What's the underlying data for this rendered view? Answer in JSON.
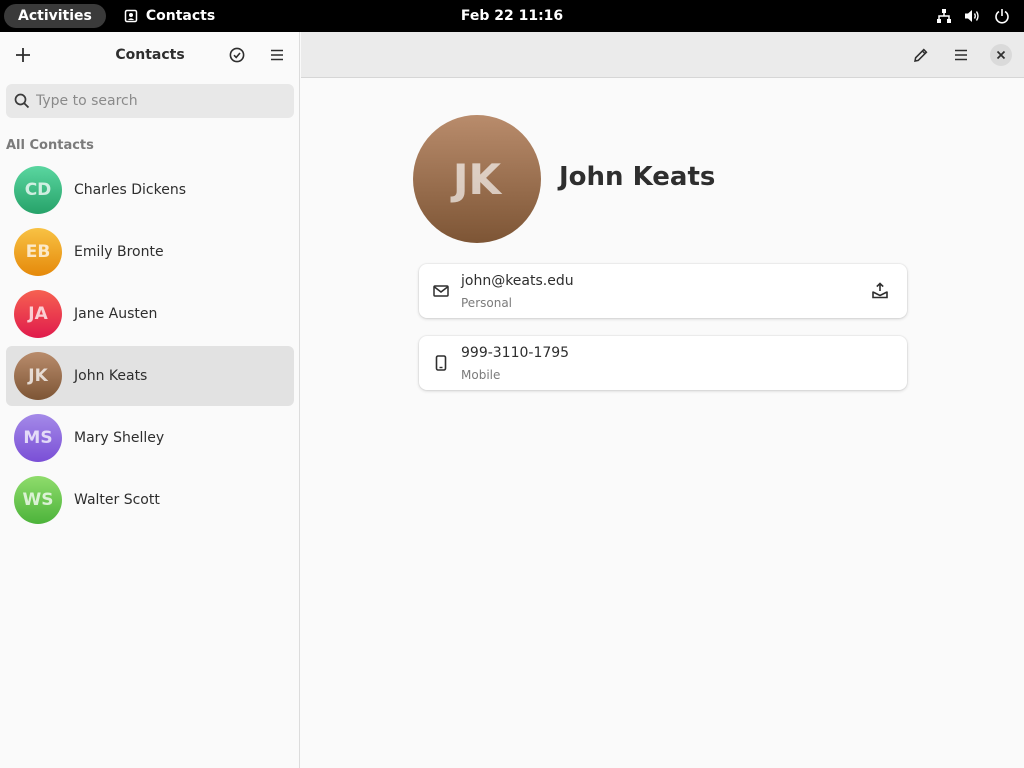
{
  "topbar": {
    "activities_label": "Activities",
    "app_name": "Contacts",
    "clock": "Feb 22  11:16",
    "icons": [
      "network-icon",
      "volume-icon",
      "power-icon"
    ]
  },
  "sidebar": {
    "title": "Contacts",
    "header_icons": [
      "add-icon",
      "select-icon",
      "menu-icon"
    ],
    "search": {
      "placeholder": "Type to search",
      "value": ""
    },
    "section_label": "All Contacts",
    "contacts": [
      {
        "initials": "CD",
        "name": "Charles Dickens",
        "color_top": "#5ad6a0",
        "color_bottom": "#26a269",
        "selected": false
      },
      {
        "initials": "EB",
        "name": "Emily Bronte",
        "color_top": "#f8c244",
        "color_bottom": "#e5890a",
        "selected": false
      },
      {
        "initials": "JA",
        "name": "Jane Austen",
        "color_top": "#f66151",
        "color_bottom": "#e01b4c",
        "selected": false
      },
      {
        "initials": "JK",
        "name": "John Keats",
        "color_top": "#b98c6c",
        "color_bottom": "#7d5535",
        "selected": true
      },
      {
        "initials": "MS",
        "name": "Mary Shelley",
        "color_top": "#a48ae8",
        "color_bottom": "#7a4fd6",
        "selected": false
      },
      {
        "initials": "WS",
        "name": "Walter Scott",
        "color_top": "#8fdc6c",
        "color_bottom": "#4cb33a",
        "selected": false
      }
    ]
  },
  "detail": {
    "initials": "JK",
    "name": "John Keats",
    "header_icons": [
      "edit-icon",
      "menu-icon",
      "close-icon"
    ],
    "email": {
      "value": "john@keats.edu",
      "type": "Personal",
      "icon": "mail-icon",
      "action_icon": "send-mail-icon"
    },
    "phone": {
      "value": "999-3110-1795",
      "type": "Mobile",
      "icon": "phone-icon"
    }
  }
}
